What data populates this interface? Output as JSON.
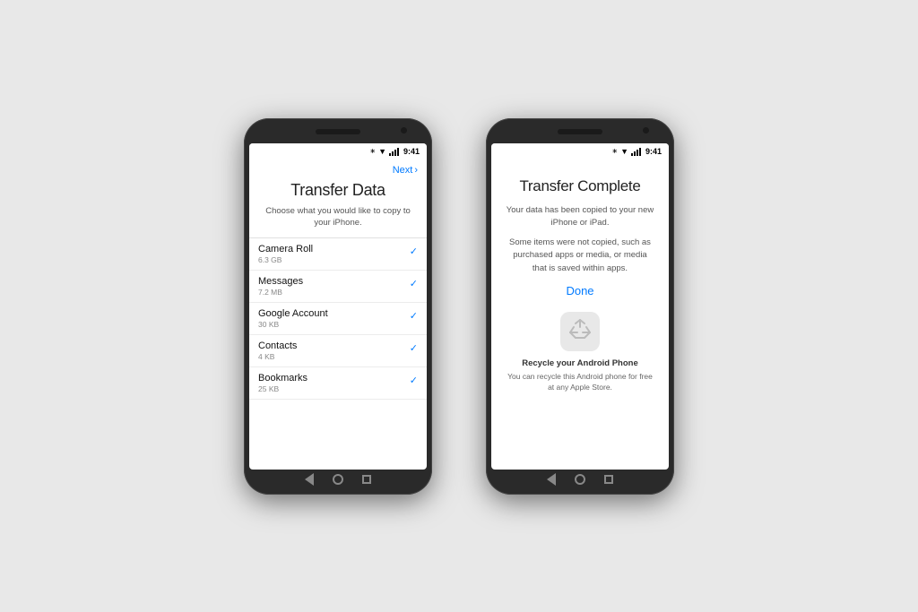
{
  "background_color": "#e8e8e8",
  "phone1": {
    "status_bar": {
      "time": "9:41"
    },
    "next_label": "Next",
    "title": "Transfer Data",
    "subtitle": "Choose what you would like to copy to your iPhone.",
    "items": [
      {
        "name": "Camera Roll",
        "size": "6.3 GB",
        "checked": true
      },
      {
        "name": "Messages",
        "size": "7.2 MB",
        "checked": true
      },
      {
        "name": "Google Account",
        "size": "30 KB",
        "checked": true
      },
      {
        "name": "Contacts",
        "size": "4 KB",
        "checked": true
      },
      {
        "name": "Bookmarks",
        "size": "25 KB",
        "checked": true
      }
    ]
  },
  "phone2": {
    "status_bar": {
      "time": "9:41"
    },
    "title": "Transfer Complete",
    "desc1": "Your data has been copied to your new iPhone or iPad.",
    "desc2": "Some items were not copied, such as purchased apps or media, or media that is saved within apps.",
    "done_label": "Done",
    "recycle_title": "Recycle your Android Phone",
    "recycle_desc": "You can recycle this Android phone for free at any Apple Store."
  }
}
